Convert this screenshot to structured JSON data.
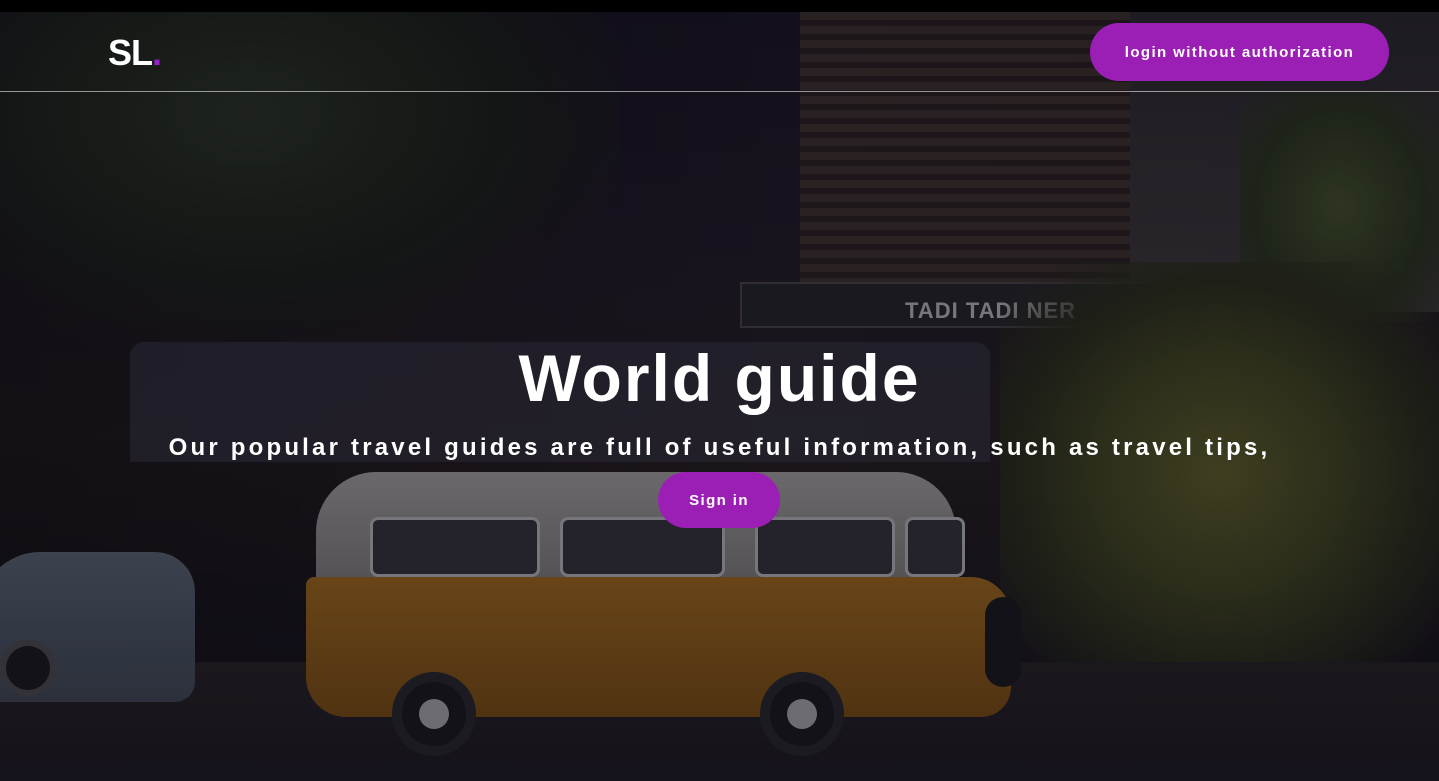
{
  "header": {
    "logo_text": "SL",
    "logo_dot": ".",
    "login_label": "login without authorization"
  },
  "hero": {
    "title": "World guide",
    "subtitle": "Our popular travel guides are full of useful information, such as travel tips,",
    "signin_label": "Sign in",
    "background_sign": "TADI  TADI  NER"
  },
  "colors": {
    "accent": "#9b1fb4",
    "logo_dot": "#9b1fc9",
    "text": "#ffffff"
  }
}
